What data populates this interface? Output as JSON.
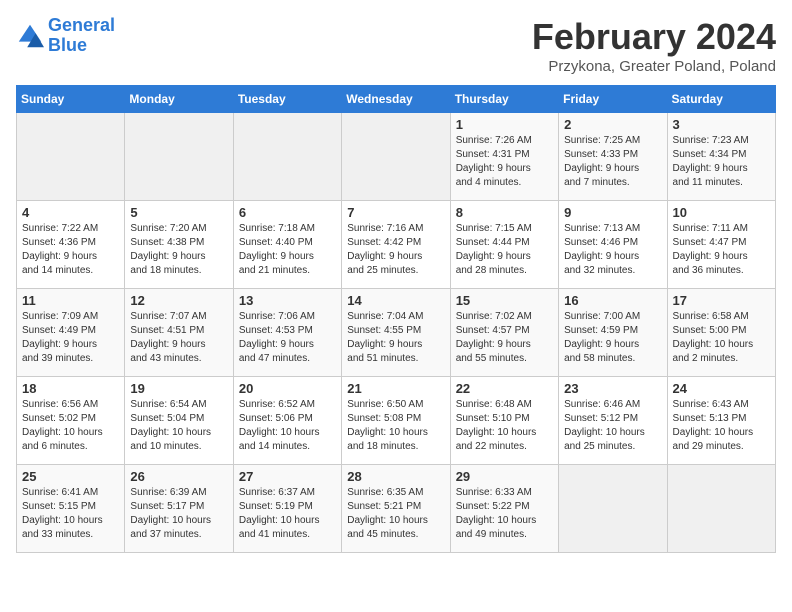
{
  "header": {
    "logo_line1": "General",
    "logo_line2": "Blue",
    "month_year": "February 2024",
    "location": "Przykona, Greater Poland, Poland"
  },
  "weekdays": [
    "Sunday",
    "Monday",
    "Tuesday",
    "Wednesday",
    "Thursday",
    "Friday",
    "Saturday"
  ],
  "weeks": [
    [
      {
        "day": "",
        "info": ""
      },
      {
        "day": "",
        "info": ""
      },
      {
        "day": "",
        "info": ""
      },
      {
        "day": "",
        "info": ""
      },
      {
        "day": "1",
        "info": "Sunrise: 7:26 AM\nSunset: 4:31 PM\nDaylight: 9 hours\nand 4 minutes."
      },
      {
        "day": "2",
        "info": "Sunrise: 7:25 AM\nSunset: 4:33 PM\nDaylight: 9 hours\nand 7 minutes."
      },
      {
        "day": "3",
        "info": "Sunrise: 7:23 AM\nSunset: 4:34 PM\nDaylight: 9 hours\nand 11 minutes."
      }
    ],
    [
      {
        "day": "4",
        "info": "Sunrise: 7:22 AM\nSunset: 4:36 PM\nDaylight: 9 hours\nand 14 minutes."
      },
      {
        "day": "5",
        "info": "Sunrise: 7:20 AM\nSunset: 4:38 PM\nDaylight: 9 hours\nand 18 minutes."
      },
      {
        "day": "6",
        "info": "Sunrise: 7:18 AM\nSunset: 4:40 PM\nDaylight: 9 hours\nand 21 minutes."
      },
      {
        "day": "7",
        "info": "Sunrise: 7:16 AM\nSunset: 4:42 PM\nDaylight: 9 hours\nand 25 minutes."
      },
      {
        "day": "8",
        "info": "Sunrise: 7:15 AM\nSunset: 4:44 PM\nDaylight: 9 hours\nand 28 minutes."
      },
      {
        "day": "9",
        "info": "Sunrise: 7:13 AM\nSunset: 4:46 PM\nDaylight: 9 hours\nand 32 minutes."
      },
      {
        "day": "10",
        "info": "Sunrise: 7:11 AM\nSunset: 4:47 PM\nDaylight: 9 hours\nand 36 minutes."
      }
    ],
    [
      {
        "day": "11",
        "info": "Sunrise: 7:09 AM\nSunset: 4:49 PM\nDaylight: 9 hours\nand 39 minutes."
      },
      {
        "day": "12",
        "info": "Sunrise: 7:07 AM\nSunset: 4:51 PM\nDaylight: 9 hours\nand 43 minutes."
      },
      {
        "day": "13",
        "info": "Sunrise: 7:06 AM\nSunset: 4:53 PM\nDaylight: 9 hours\nand 47 minutes."
      },
      {
        "day": "14",
        "info": "Sunrise: 7:04 AM\nSunset: 4:55 PM\nDaylight: 9 hours\nand 51 minutes."
      },
      {
        "day": "15",
        "info": "Sunrise: 7:02 AM\nSunset: 4:57 PM\nDaylight: 9 hours\nand 55 minutes."
      },
      {
        "day": "16",
        "info": "Sunrise: 7:00 AM\nSunset: 4:59 PM\nDaylight: 9 hours\nand 58 minutes."
      },
      {
        "day": "17",
        "info": "Sunrise: 6:58 AM\nSunset: 5:00 PM\nDaylight: 10 hours\nand 2 minutes."
      }
    ],
    [
      {
        "day": "18",
        "info": "Sunrise: 6:56 AM\nSunset: 5:02 PM\nDaylight: 10 hours\nand 6 minutes."
      },
      {
        "day": "19",
        "info": "Sunrise: 6:54 AM\nSunset: 5:04 PM\nDaylight: 10 hours\nand 10 minutes."
      },
      {
        "day": "20",
        "info": "Sunrise: 6:52 AM\nSunset: 5:06 PM\nDaylight: 10 hours\nand 14 minutes."
      },
      {
        "day": "21",
        "info": "Sunrise: 6:50 AM\nSunset: 5:08 PM\nDaylight: 10 hours\nand 18 minutes."
      },
      {
        "day": "22",
        "info": "Sunrise: 6:48 AM\nSunset: 5:10 PM\nDaylight: 10 hours\nand 22 minutes."
      },
      {
        "day": "23",
        "info": "Sunrise: 6:46 AM\nSunset: 5:12 PM\nDaylight: 10 hours\nand 25 minutes."
      },
      {
        "day": "24",
        "info": "Sunrise: 6:43 AM\nSunset: 5:13 PM\nDaylight: 10 hours\nand 29 minutes."
      }
    ],
    [
      {
        "day": "25",
        "info": "Sunrise: 6:41 AM\nSunset: 5:15 PM\nDaylight: 10 hours\nand 33 minutes."
      },
      {
        "day": "26",
        "info": "Sunrise: 6:39 AM\nSunset: 5:17 PM\nDaylight: 10 hours\nand 37 minutes."
      },
      {
        "day": "27",
        "info": "Sunrise: 6:37 AM\nSunset: 5:19 PM\nDaylight: 10 hours\nand 41 minutes."
      },
      {
        "day": "28",
        "info": "Sunrise: 6:35 AM\nSunset: 5:21 PM\nDaylight: 10 hours\nand 45 minutes."
      },
      {
        "day": "29",
        "info": "Sunrise: 6:33 AM\nSunset: 5:22 PM\nDaylight: 10 hours\nand 49 minutes."
      },
      {
        "day": "",
        "info": ""
      },
      {
        "day": "",
        "info": ""
      }
    ]
  ]
}
